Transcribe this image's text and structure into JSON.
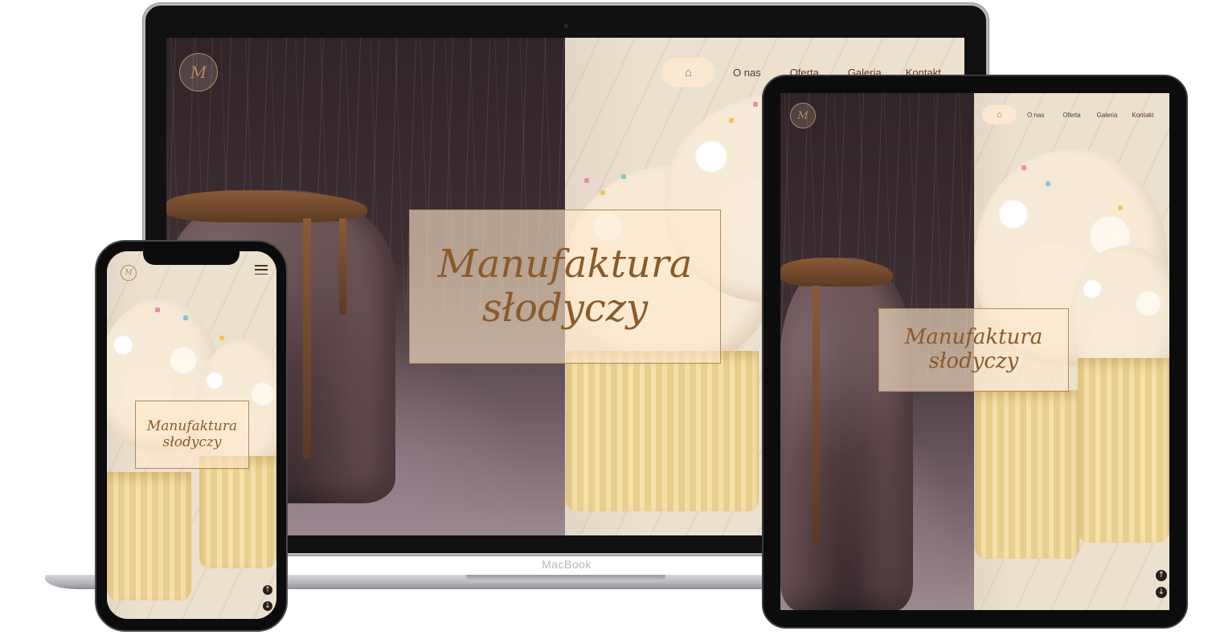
{
  "devices": {
    "laptop_brand": "MacBook"
  },
  "site": {
    "logo_mark": "M",
    "nav": {
      "home_icon": "home-icon",
      "items": [
        "O nas",
        "Oferta",
        "Galeria",
        "Kontakt"
      ]
    },
    "hero": {
      "line1": "Manufaktura",
      "line2": "słodyczy"
    },
    "scroll": {
      "up_icon": "arrow-up-circle-icon",
      "down_icon": "arrow-down-circle-icon",
      "up_glyph": "↑",
      "down_glyph": "↓"
    },
    "colors": {
      "accent": "#b58a5a",
      "hero_text": "#8a5a2b",
      "nav_pill": "#fbe8d2",
      "nav_text": "#5a3b20"
    }
  }
}
